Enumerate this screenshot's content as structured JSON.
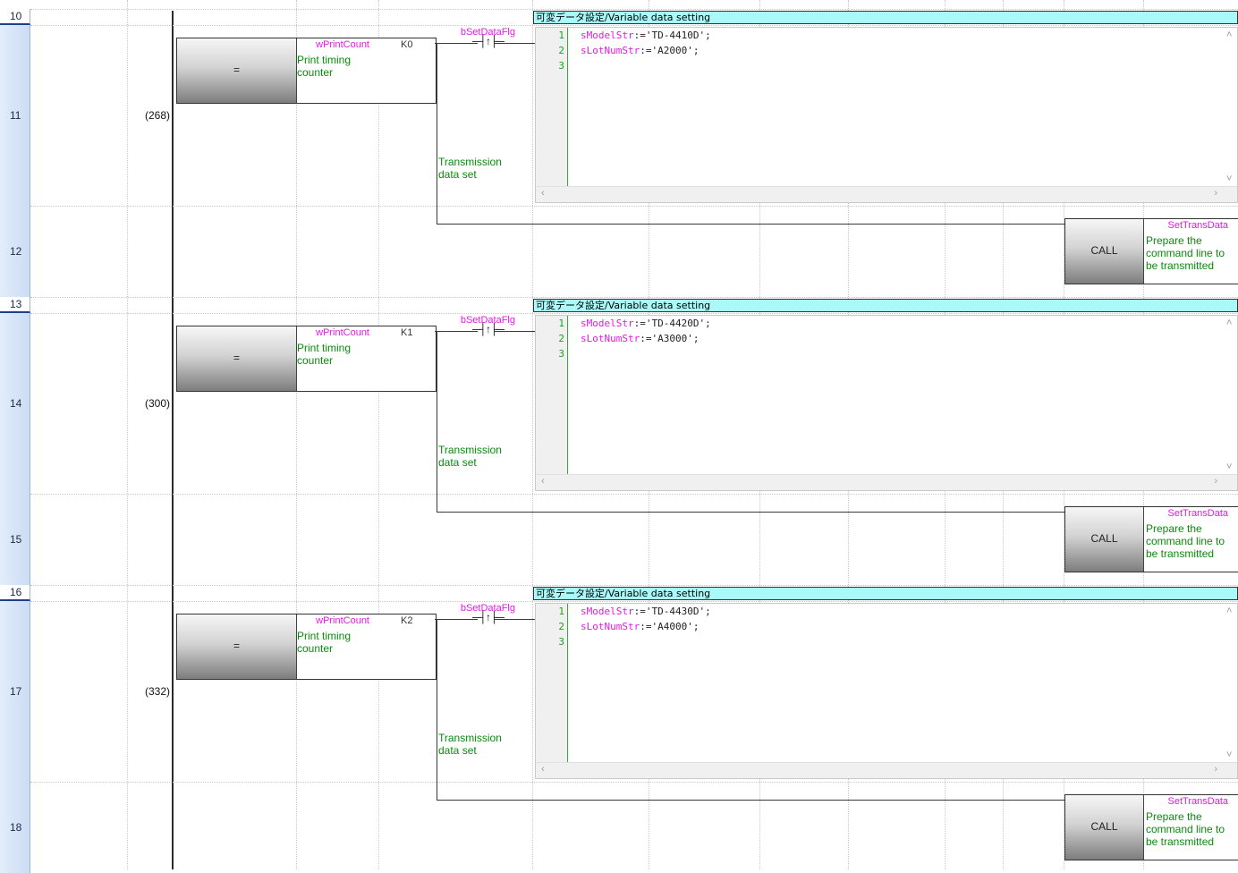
{
  "window": {
    "title": ""
  },
  "rows": [
    {
      "row": "10",
      "header": true
    },
    {
      "row": "11",
      "step": "(268)"
    },
    {
      "row": "12"
    },
    {
      "row": "13",
      "header": true
    },
    {
      "row": "14",
      "step": "(300)"
    },
    {
      "row": "15"
    },
    {
      "row": "16",
      "header": true
    },
    {
      "row": "17",
      "step": "(332)"
    },
    {
      "row": "18"
    }
  ],
  "rungs": [
    {
      "header": "可変データ設定/Variable data setting",
      "compare_op": "=",
      "device": "wPrintCount",
      "device_comment": [
        "Print timing",
        "counter"
      ],
      "constant": "K0",
      "contact_label": "bSetDataFlg",
      "contact_symbol": "─┤↑├─",
      "coil_comment": [
        "Transmission",
        "data set"
      ],
      "code_lines": [
        {
          "num": "1",
          "var": "sModelStr",
          "rest": ":='TD-4410D';"
        },
        {
          "num": "2",
          "var": "sLotNumStr",
          "rest": ":='A2000';"
        },
        {
          "num": "3",
          "var": "",
          "rest": ""
        }
      ],
      "call": {
        "label": "CALL",
        "target": "SetTransData",
        "comment": [
          "Prepare the",
          "command line to",
          "be transmitted"
        ]
      }
    },
    {
      "header": "可変データ設定/Variable data setting",
      "compare_op": "=",
      "device": "wPrintCount",
      "device_comment": [
        "Print timing",
        "counter"
      ],
      "constant": "K1",
      "contact_label": "bSetDataFlg",
      "contact_symbol": "─┤↑├─",
      "coil_comment": [
        "Transmission",
        "data set"
      ],
      "code_lines": [
        {
          "num": "1",
          "var": "sModelStr",
          "rest": ":='TD-4420D';"
        },
        {
          "num": "2",
          "var": "sLotNumStr",
          "rest": ":='A3000';"
        },
        {
          "num": "3",
          "var": "",
          "rest": ""
        }
      ],
      "call": {
        "label": "CALL",
        "target": "SetTransData",
        "comment": [
          "Prepare the",
          "command line to",
          "be transmitted"
        ]
      }
    },
    {
      "header": "可変データ設定/Variable data setting",
      "compare_op": "=",
      "device": "wPrintCount",
      "device_comment": [
        "Print timing",
        "counter"
      ],
      "constant": "K2",
      "contact_label": "bSetDataFlg",
      "contact_symbol": "─┤↑├─",
      "coil_comment": [
        "Transmission",
        "data set"
      ],
      "code_lines": [
        {
          "num": "1",
          "var": "sModelStr",
          "rest": ":='TD-4430D';"
        },
        {
          "num": "2",
          "var": "sLotNumStr",
          "rest": ":='A4000';"
        },
        {
          "num": "3",
          "var": "",
          "rest": ""
        }
      ],
      "call": {
        "label": "CALL",
        "target": "SetTransData",
        "comment": [
          "Prepare the",
          "command line to",
          "be transmitted"
        ]
      }
    }
  ],
  "colors": {
    "variable": "#e21be2",
    "comment": "#0b8a0b",
    "header_bg": "#aaf9f9",
    "row_header": "#cbdcf4"
  },
  "icons": {
    "scroll_left": "‹",
    "scroll_right": "›",
    "scroll_up": "˄",
    "scroll_down": "˅"
  }
}
